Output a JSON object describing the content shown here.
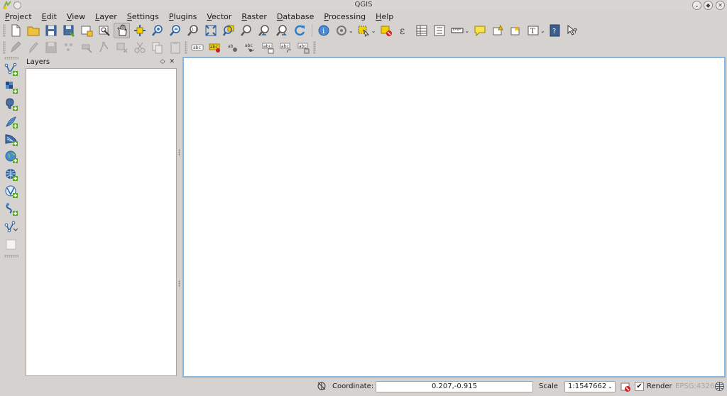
{
  "window": {
    "title": "QGIS",
    "logo_icon": "qgis-logo-icon",
    "controls": [
      "minimize-icon",
      "maximize-icon",
      "close-icon"
    ]
  },
  "menubar": {
    "items": [
      "Project",
      "Edit",
      "View",
      "Layer",
      "Settings",
      "Plugins",
      "Vector",
      "Raster",
      "Database",
      "Processing",
      "Help"
    ]
  },
  "toolbar_main": {
    "icons": [
      "new-project-icon",
      "open-project-icon",
      "save-project-icon",
      "save-as-icon",
      "new-print-composer-icon",
      "composer-manager-icon",
      "pan-icon",
      "pan-to-selection-icon",
      "zoom-in-icon",
      "zoom-out-icon",
      "zoom-native-icon",
      "zoom-full-icon",
      "zoom-to-selection-icon",
      "zoom-to-layer-icon",
      "zoom-last-icon",
      "zoom-next-icon",
      "refresh-icon",
      "identify-icon",
      "action-icon",
      "select-icon",
      "deselect-icon",
      "field-calculator-icon",
      "attribute-table-icon",
      "statistics-icon",
      "measure-icon",
      "map-tips-icon",
      "new-bookmark-icon",
      "show-bookmarks-icon",
      "text-annotation-icon",
      "help-icon",
      "whats-this-icon"
    ]
  },
  "toolbar_secondary": {
    "icons": [
      "current-edits-icon",
      "toggle-editing-icon",
      "save-edits-icon",
      "add-feature-icon",
      "move-feature-icon",
      "node-tool-icon",
      "delete-selected-icon",
      "cut-features-icon",
      "copy-features-icon",
      "paste-features-icon",
      "label-tool-icon",
      "pin-labels-icon",
      "show-hide-labels-icon",
      "move-label-icon",
      "rotate-label-icon",
      "change-label-icon"
    ],
    "label_text": "abc"
  },
  "left_toolbar": {
    "icons": [
      "add-vector-layer-icon",
      "add-raster-layer-icon",
      "add-postgis-layer-icon",
      "add-spatialite-layer-icon",
      "add-mssql-layer-icon",
      "add-wms-layer-icon",
      "add-wcs-layer-icon",
      "add-wfs-layer-icon",
      "add-delimited-text-layer-icon",
      "new-vector-layer-icon",
      "add-virtual-layer-icon"
    ]
  },
  "layers_panel": {
    "title": "Layers",
    "float_glyph": "◇",
    "close_glyph": "✕"
  },
  "statusbar": {
    "coordinate_label": "Coordinate:",
    "coordinate_value": "0.207,-0.915",
    "scale_label": "Scale",
    "scale_value": "1:1547662",
    "render_label": "Render",
    "render_checked": true,
    "crs_label": "EPSG:4326"
  },
  "colors": {
    "window_bg": "#d6d2d0",
    "canvas_border": "#86b6e0",
    "canvas_bg": "#ffffff",
    "accent_green": "#5aa02c",
    "accent_blue": "#2a5f9e"
  }
}
